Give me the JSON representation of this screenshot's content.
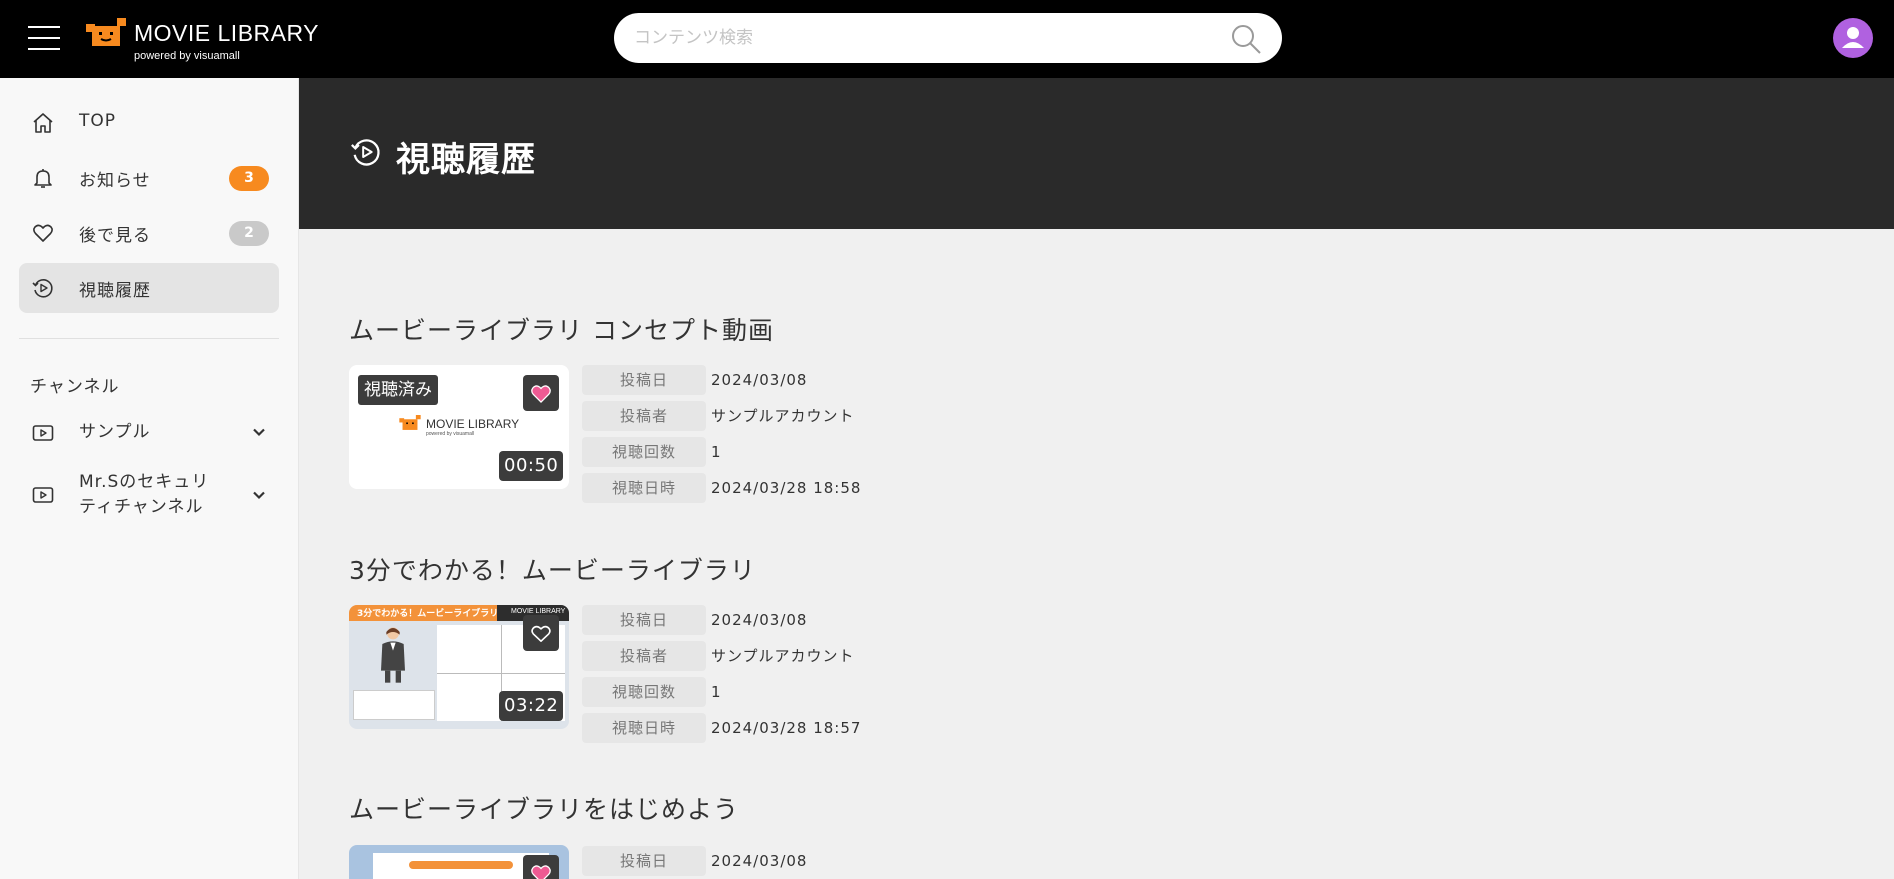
{
  "header": {
    "logo_title": "MOVIE LIBRARY",
    "logo_sub": "powered by visuamall",
    "search_placeholder": "コンテンツ検索"
  },
  "sidebar": {
    "items": [
      {
        "label": "TOP",
        "icon": "home-icon"
      },
      {
        "label": "お知らせ",
        "icon": "bell-icon",
        "badge": "3"
      },
      {
        "label": "後で見る",
        "icon": "heart-icon",
        "badge": "2"
      },
      {
        "label": "視聴履歴",
        "icon": "history-icon",
        "active": true
      }
    ],
    "section_label": "チャンネル",
    "channels": [
      {
        "label": "サンプル",
        "icon": "play-box-icon"
      },
      {
        "label": "Mr.Sのセキュリティチャンネル",
        "label_line1": "Mr.Sのセキュリ",
        "label_line2": "ティチャンネル",
        "icon": "play-box-icon"
      }
    ]
  },
  "page": {
    "title": "視聴履歴"
  },
  "meta_labels": {
    "posted_date": "投稿日",
    "poster": "投稿者",
    "view_count": "視聴回数",
    "viewed_at": "視聴日時"
  },
  "videos": [
    {
      "title": "ムービーライブラリ コンセプト動画",
      "watched_label": "視聴済み",
      "thumb_logo_title": "MOVIE LIBRARY",
      "thumb_logo_sub": "powered by visuamall",
      "duration": "00:50",
      "favorited": true,
      "posted_date": "2024/03/08",
      "poster": "サンプルアカウント",
      "view_count": "1",
      "viewed_at": "2024/03/28 18:58"
    },
    {
      "title": "3分でわかる！ムービーライブラリ",
      "thumb_banner": "3分でわかる！ムービーライブラリ",
      "thumb_logo_title": "MOVIE LIBRARY",
      "duration": "03:22",
      "favorited": false,
      "posted_date": "2024/03/08",
      "poster": "サンプルアカウント",
      "view_count": "1",
      "viewed_at": "2024/03/28 18:57"
    },
    {
      "title": "ムービーライブラリをはじめよう",
      "favorited": true,
      "posted_date": "2024/03/08"
    }
  ],
  "colors": {
    "header_bg": "#000000",
    "accent_orange": "#f78a1f",
    "avatar": "#b061e0",
    "heart_pink": "#ee5a93",
    "page_header_bg": "#2a2a2a"
  }
}
